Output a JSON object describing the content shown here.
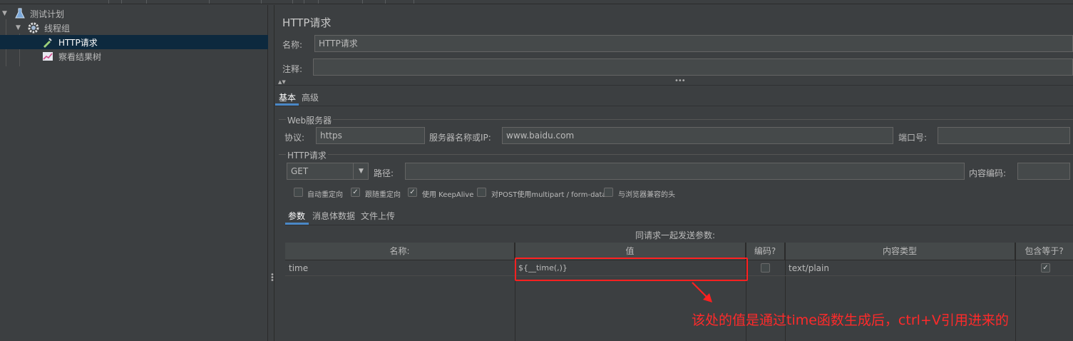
{
  "tree": {
    "items": [
      {
        "label": "测试计划",
        "icon": "flask-icon"
      },
      {
        "label": "线程组",
        "icon": "gear-icon"
      },
      {
        "label": "HTTP请求",
        "icon": "pipette-icon"
      },
      {
        "label": "察看结果树",
        "icon": "chart-icon"
      }
    ]
  },
  "panel": {
    "title": "HTTP请求",
    "name_label": "名称:",
    "name_value": "HTTP请求",
    "comment_label": "注释:",
    "comment_value": "",
    "tabs": [
      "基本",
      "高级"
    ],
    "web_server": {
      "group_label": "Web服务器",
      "protocol_label": "协议:",
      "protocol_value": "https",
      "server_label": "服务器名称或IP:",
      "server_value": "www.baidu.com",
      "port_label": "端口号:",
      "port_value": ""
    },
    "http_request": {
      "group_label": "HTTP请求",
      "method": "GET",
      "path_label": "路径:",
      "path_value": "",
      "encoding_label": "内容编码:",
      "encoding_value": ""
    },
    "options": [
      {
        "label": "自动重定向",
        "checked": false
      },
      {
        "label": "跟随重定向",
        "checked": true
      },
      {
        "label": "使用 KeepAlive",
        "checked": true
      },
      {
        "label": "对POST使用multipart / form-data",
        "checked": false
      },
      {
        "label": "与浏览器兼容的头",
        "checked": false
      }
    ],
    "sub_tabs": [
      "参数",
      "消息体数据",
      "文件上传"
    ],
    "params_caption": "同请求一起发送参数:",
    "table": {
      "headers": [
        "名称:",
        "值",
        "编码?",
        "内容类型",
        "包含等于?"
      ],
      "rows": [
        {
          "name": "time",
          "value": "${__time(,)}",
          "encode": false,
          "content_type": "text/plain",
          "include_equals": true
        }
      ]
    }
  },
  "annotation": "该处的值是通过time函数生成后，ctrl+V引用进来的",
  "colors": {
    "accent": "#4a88c7",
    "annotation": "#ff2a2a",
    "selection": "#0d293e"
  }
}
